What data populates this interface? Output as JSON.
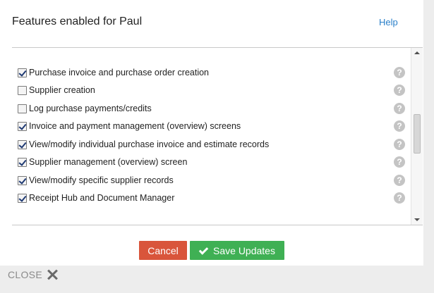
{
  "dialog": {
    "title": "Features enabled for Paul",
    "help_label": "Help"
  },
  "features": [
    {
      "label": "Purchase invoice and purchase order creation",
      "checked": true
    },
    {
      "label": "Supplier creation",
      "checked": false
    },
    {
      "label": "Log purchase payments/credits",
      "checked": false
    },
    {
      "label": "Invoice and payment management (overview) screens",
      "checked": true
    },
    {
      "label": "View/modify individual purchase invoice and estimate records",
      "checked": true
    },
    {
      "label": "Supplier management (overview) screen",
      "checked": true
    },
    {
      "label": "View/modify specific supplier records",
      "checked": true
    },
    {
      "label": "Receipt Hub and Document Manager",
      "checked": true
    }
  ],
  "help_icon_glyph": "?",
  "buttons": {
    "cancel_label": "Cancel",
    "save_label": "Save Updates"
  },
  "close_label": "CLOSE",
  "colors": {
    "cancel": "#d9553b",
    "save": "#3fb054",
    "help_link": "#2a7fc9"
  },
  "icons": {
    "help": "question-circle-icon",
    "save": "check-icon",
    "close": "close-x-icon"
  }
}
